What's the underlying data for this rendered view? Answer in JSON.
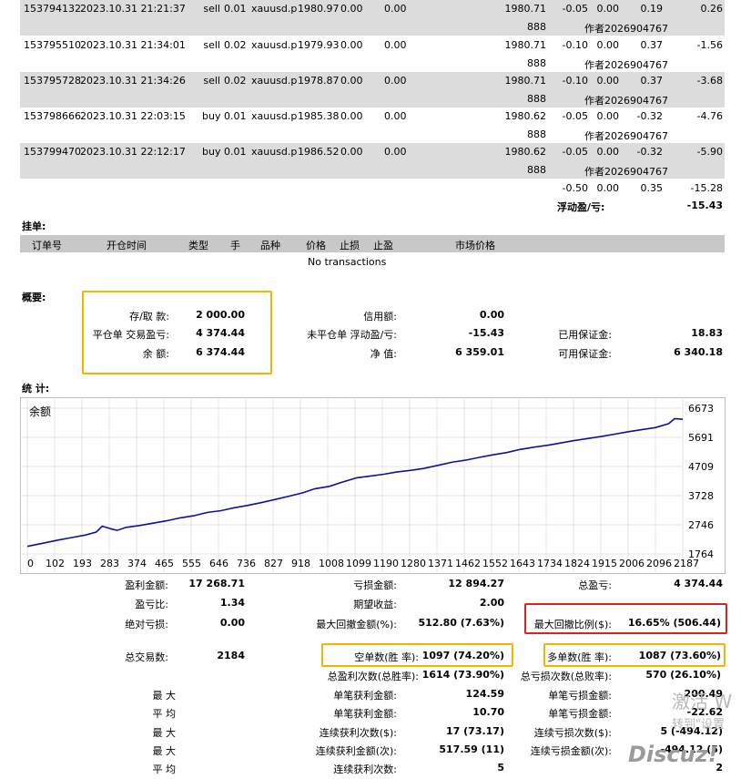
{
  "trades": [
    {
      "ticket": "153794132",
      "open_time": "2023.10.31 21:21:37",
      "type": "sell",
      "size": "0.01",
      "item": "xauusd.p",
      "price": "1980.97",
      "sl": "0.00",
      "tp": "0.00",
      "market_price": "1980.71",
      "market_price2": "888",
      "commission": "-0.05",
      "taxes": "0.00",
      "swap": "0.19",
      "profit": "0.26",
      "comment": "作者2026904767"
    },
    {
      "ticket": "153795510",
      "open_time": "2023.10.31 21:34:01",
      "type": "sell",
      "size": "0.02",
      "item": "xauusd.p",
      "price": "1979.93",
      "sl": "0.00",
      "tp": "0.00",
      "market_price": "1980.71",
      "market_price2": "888",
      "commission": "-0.10",
      "taxes": "0.00",
      "swap": "0.37",
      "profit": "-1.56",
      "comment": "作者2026904767"
    },
    {
      "ticket": "153795728",
      "open_time": "2023.10.31 21:34:26",
      "type": "sell",
      "size": "0.02",
      "item": "xauusd.p",
      "price": "1978.87",
      "sl": "0.00",
      "tp": "0.00",
      "market_price": "1980.71",
      "market_price2": "888",
      "commission": "-0.10",
      "taxes": "0.00",
      "swap": "0.37",
      "profit": "-3.68",
      "comment": "作者2026904767"
    },
    {
      "ticket": "153798666",
      "open_time": "2023.10.31 22:03:15",
      "type": "buy",
      "size": "0.01",
      "item": "xauusd.p",
      "price": "1985.38",
      "sl": "0.00",
      "tp": "0.00",
      "market_price": "1980.62",
      "market_price2": "888",
      "commission": "-0.05",
      "taxes": "0.00",
      "swap": "-0.32",
      "profit": "-4.76",
      "comment": "作者2026904767"
    },
    {
      "ticket": "153799470",
      "open_time": "2023.10.31 22:12:17",
      "type": "buy",
      "size": "0.01",
      "item": "xauusd.p",
      "price": "1986.52",
      "sl": "0.00",
      "tp": "0.00",
      "market_price": "1980.62",
      "market_price2": "888",
      "commission": "-0.05",
      "taxes": "0.00",
      "swap": "-0.32",
      "profit": "-5.90",
      "comment": "作者2026904767"
    }
  ],
  "totals": {
    "commission": "-0.50",
    "taxes": "0.00",
    "swap": "0.35",
    "profit": "-15.28",
    "floating_label": "浮动盈/亏:",
    "floating_value": "-15.43"
  },
  "pending": {
    "section_title": "挂单:",
    "headers": [
      "订单号",
      "开仓时间",
      "类型",
      "手",
      "品种",
      "价格",
      "止损",
      "止盈",
      "市场价格"
    ],
    "empty": "No transactions"
  },
  "summary": {
    "section_title": "概要:",
    "deposit_label": "存/取 款:",
    "deposit_value": "2 000.00",
    "closed_pl_label": "平仓单 交易盈亏:",
    "closed_pl_value": "4 374.44",
    "balance_label": "余 额:",
    "balance_value": "6 374.44",
    "credit_label": "信用额:",
    "credit_value": "0.00",
    "floating_pl_label": "未平仓单 浮动盈/亏:",
    "floating_pl_value": "-15.43",
    "equity_label": "净 值:",
    "equity_value": "6 359.01",
    "margin_label": "已用保证金:",
    "margin_value": "18.83",
    "free_margin_label": "可用保证金:",
    "free_margin_value": "6 340.18"
  },
  "stats_title": "统 计:",
  "chart_data": {
    "type": "line",
    "title": "余额",
    "x_ticks": [
      "0",
      "102",
      "193",
      "283",
      "374",
      "465",
      "555",
      "646",
      "736",
      "827",
      "918",
      "1008",
      "1099",
      "1190",
      "1280",
      "1371",
      "1462",
      "1552",
      "1643",
      "1734",
      "1824",
      "1915",
      "2006",
      "2096",
      "2187"
    ],
    "y_ticks": [
      "6673",
      "5691",
      "4709",
      "3728",
      "2746",
      "1764"
    ],
    "ylim": [
      1764,
      6673
    ],
    "xlim": [
      0,
      2187
    ],
    "line_color": "#1010a0",
    "grid": true,
    "series": [
      {
        "x": [
          0,
          30,
          60,
          102,
          150,
          193,
          230,
          250,
          283,
          300,
          330,
          374,
          420,
          465,
          510,
          555,
          600,
          646,
          690,
          736,
          780,
          827,
          870,
          918,
          960,
          1008,
          1050,
          1099,
          1140,
          1190,
          1230,
          1280,
          1320,
          1371,
          1420,
          1462,
          1510,
          1552,
          1600,
          1643,
          1690,
          1734,
          1780,
          1824,
          1870,
          1915,
          1960,
          2006,
          2050,
          2096,
          2140,
          2160,
          2187
        ],
        "y": [
          2020,
          2080,
          2140,
          2230,
          2320,
          2400,
          2500,
          2700,
          2600,
          2560,
          2660,
          2720,
          2800,
          2880,
          2980,
          3050,
          3160,
          3220,
          3320,
          3400,
          3490,
          3600,
          3700,
          3820,
          3960,
          4040,
          4180,
          4330,
          4380,
          4450,
          4520,
          4580,
          4640,
          4750,
          4860,
          4920,
          5020,
          5100,
          5180,
          5280,
          5360,
          5420,
          5500,
          5580,
          5650,
          5720,
          5800,
          5880,
          5950,
          6020,
          6150,
          6320,
          6300
        ]
      }
    ]
  },
  "stats": {
    "gross_profit_label": "盈利金额:",
    "gross_profit": "17 268.71",
    "gross_loss_label": "亏损金额:",
    "gross_loss": "12 894.27",
    "total_net_label": "总盈亏:",
    "total_net": "4 374.44",
    "profit_factor_label": "盈亏比:",
    "profit_factor": "1.34",
    "expected_payoff_label": "期望收益:",
    "expected_payoff": "2.00",
    "abs_drawdown_label": "绝对亏损:",
    "abs_drawdown": "0.00",
    "max_drawdown_label": "最大回撤金额(%):",
    "max_drawdown": "512.80 (7.63%)",
    "rel_drawdown_label": "最大回撤比例($):",
    "rel_drawdown": "16.65% (506.44)",
    "total_trades_label": "总交易数:",
    "total_trades": "2184",
    "short_label": "空单数(胜 率):",
    "short": "1097 (74.20%)",
    "long_label": "多单数(胜 率):",
    "long": "1087 (73.60%)",
    "profit_trades_label": "总盈利次数(总胜率):",
    "profit_trades": "1614 (73.90%)",
    "loss_trades_label": "总亏损次数(总败率):",
    "loss_trades": "570 (26.10%)",
    "largest_label": "最 大",
    "largest_profit_label": "单笔获利金额:",
    "largest_profit": "124.59",
    "largest_loss_label": "单笔亏损金额:",
    "largest_loss": "200.49",
    "average_label": "平 均",
    "avg_profit_label": "单笔获利金额:",
    "avg_profit": "10.70",
    "avg_loss_label": "单笔亏损金额:",
    "avg_loss": "-22.62",
    "max_label": "最 大",
    "max_consec_wins_label": "连续获利次数($):",
    "max_consec_wins": "17 (73.17)",
    "max_consec_losses_label": "连续亏损次数($):",
    "max_consec_losses": "5 (-494.12)",
    "max2_label": "最 大",
    "max_consec_profit_label": "连续获利金额(次):",
    "max_consec_profit": "517.59 (11)",
    "max_consec_loss_label": "连续亏损金额(次):",
    "max_consec_loss": "-494.12 (5)",
    "avg2_label": "平 均",
    "avg_consec_wins_label": "连续获利次数:",
    "avg_consec_wins": "5",
    "avg_consec_losses_value": "2"
  },
  "watermark": {
    "line1": "激活 W",
    "line2": "转到\"设置",
    "logo": "Discuz!"
  }
}
